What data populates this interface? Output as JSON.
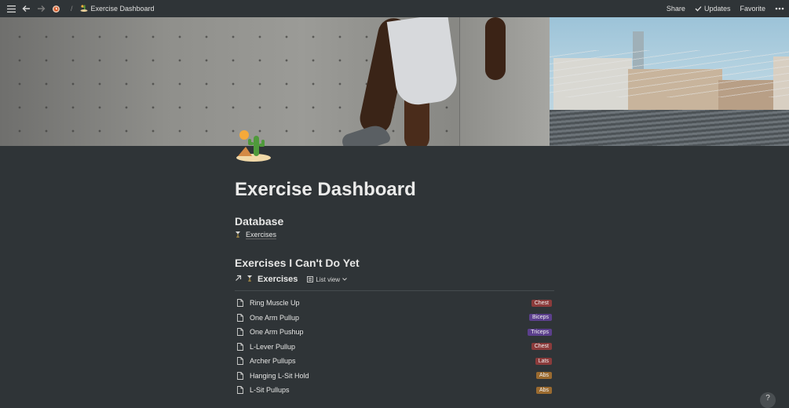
{
  "topbar": {
    "breadcrumb_title": "Exercise Dashboard",
    "separator": "/",
    "share": "Share",
    "updates": "Updates",
    "favorite": "Favorite"
  },
  "page": {
    "title": "Exercise Dashboard"
  },
  "sections": {
    "database_heading": "Database",
    "database_link": "Exercises",
    "cant_do_heading": "Exercises I Can't Do Yet"
  },
  "linked_view": {
    "title": "Exercises",
    "view_label": "List view"
  },
  "exercises": [
    {
      "name": "Ring Muscle Up",
      "tag": "Chest",
      "tag_color": "#8b3b3b"
    },
    {
      "name": "One Arm Pullup",
      "tag": "Biceps",
      "tag_color": "#5b3f8c"
    },
    {
      "name": "One Arm Pushup",
      "tag": "Triceps",
      "tag_color": "#5b3f8c"
    },
    {
      "name": "L-Lever Pullup",
      "tag": "Chest",
      "tag_color": "#8b3b3b"
    },
    {
      "name": "Archer Pullups",
      "tag": "Lats",
      "tag_color": "#8b3b3b"
    },
    {
      "name": "Hanging L-Sit Hold",
      "tag": "Abs",
      "tag_color": "#9a6a2f"
    },
    {
      "name": "L-Sit Pullups",
      "tag": "Abs",
      "tag_color": "#9a6a2f"
    }
  ],
  "icons": {
    "menu": "menu-icon",
    "back": "arrow-left-icon",
    "forward": "arrow-right-icon",
    "clock": "clock-icon",
    "page": "cactus-desert-icon",
    "check": "check-icon",
    "more": "more-dots-icon"
  },
  "help_label": "?"
}
